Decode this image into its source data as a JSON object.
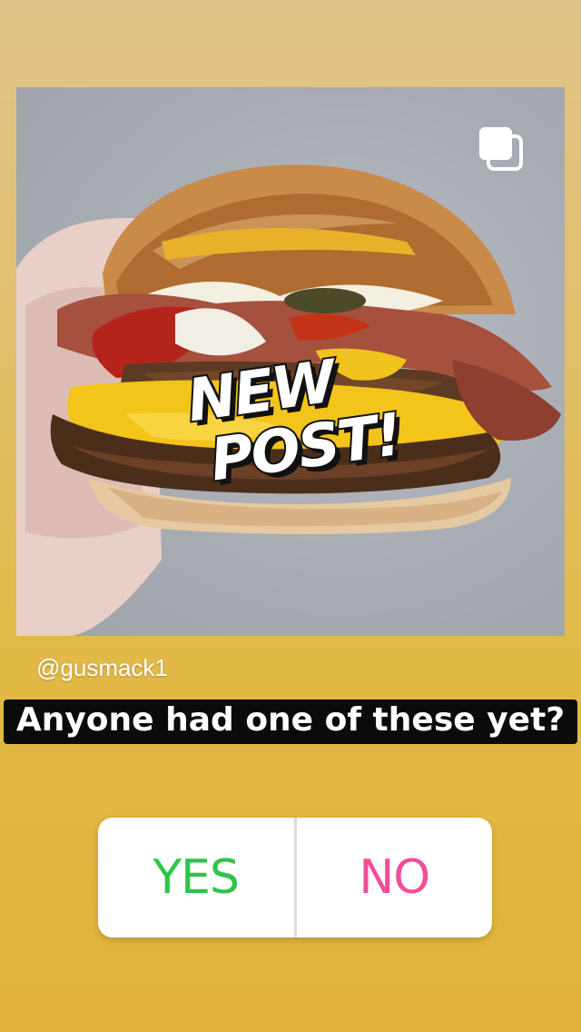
{
  "post": {
    "username": "@gusmack1",
    "sticker_line1": "NEW",
    "sticker_line2": "POST!",
    "multi_photo_icon": "stacked-squares-icon"
  },
  "question": {
    "text": "Anyone had one of these yet?"
  },
  "poll": {
    "yes_label": "YES",
    "no_label": "NO",
    "yes_color": "#2ec44a",
    "no_color": "#f04d9a"
  },
  "colors": {
    "background_top": "#dfc48a",
    "background_bottom": "#e2b43b"
  }
}
